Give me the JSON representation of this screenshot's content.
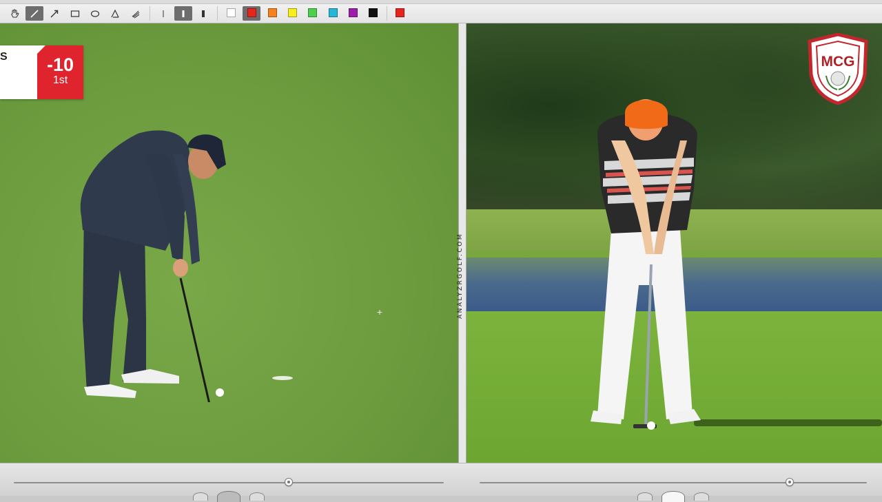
{
  "toolbar": {
    "tools": [
      {
        "name": "hand-tool",
        "icon": "hand-icon",
        "active": false
      },
      {
        "name": "line-tool",
        "icon": "line-icon",
        "active": true
      },
      {
        "name": "arrow-tool",
        "icon": "arrow-icon",
        "active": false
      },
      {
        "name": "rectangle-tool",
        "icon": "rectangle-icon",
        "active": false
      },
      {
        "name": "ellipse-tool",
        "icon": "ellipse-icon",
        "active": false
      },
      {
        "name": "angle-tool",
        "icon": "angle-icon",
        "active": false
      },
      {
        "name": "freehand-tool",
        "icon": "freehand-icon",
        "active": false
      }
    ],
    "line_widths": [
      {
        "name": "thin",
        "active": false
      },
      {
        "name": "medium",
        "active": true
      },
      {
        "name": "thick",
        "active": false
      }
    ],
    "colors": [
      "#ffffff",
      "#e8241f",
      "#f5821f",
      "#f7ef20",
      "#4fcf4f",
      "#27b5d8",
      "#9b1fa8",
      "#111111"
    ],
    "selected_color_index": 1,
    "current_color": "#e8241f"
  },
  "left_video": {
    "scoreboard": {
      "left_text": "S",
      "score": "-10",
      "position": "1st"
    }
  },
  "divider": {
    "watermark": "ANALYZRGOLF.COM"
  },
  "right_video": {
    "logo_text": "MCG"
  },
  "controls": {
    "left_scrubber_position": 0.64,
    "right_scrubber_position": 0.8
  }
}
